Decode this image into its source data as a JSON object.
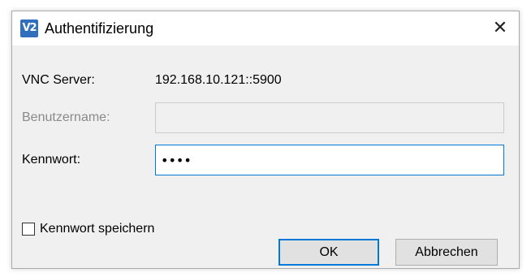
{
  "window": {
    "title": "Authentifizierung",
    "app_icon_text": "V2",
    "close_glyph": "✕"
  },
  "form": {
    "server_label": "VNC Server:",
    "server_value": "192.168.10.121::5900",
    "username_label": "Benutzername:",
    "username_value": "",
    "password_label": "Kennwort:",
    "password_value": "abcd",
    "remember_label": "Kennwort speichern",
    "remember_checked": false
  },
  "buttons": {
    "ok_label": "OK",
    "cancel_label": "Abbrechen"
  },
  "colors": {
    "accent": "#0078d7",
    "icon_bg": "#2f6fbd",
    "dialog_bg": "#f0f0f0"
  }
}
